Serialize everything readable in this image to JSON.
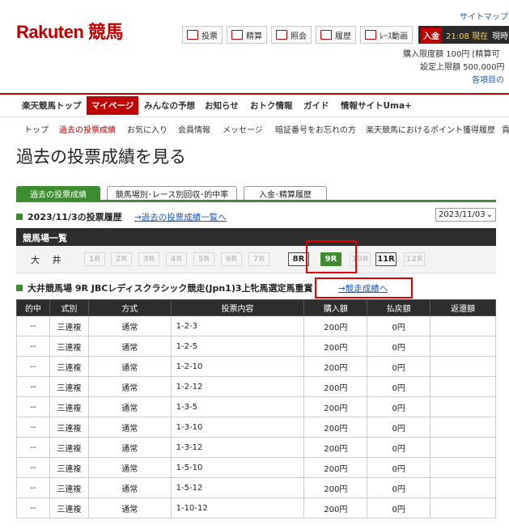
{
  "header": {
    "logo": "Rakuten 競馬",
    "sitemap": "サイトマップ",
    "tools": [
      {
        "label": "投票",
        "icon": "vote-icon"
      },
      {
        "label": "精算",
        "icon": "yen-icon"
      },
      {
        "label": "照会",
        "icon": "inquiry-icon"
      },
      {
        "label": "履歴",
        "icon": "history-icon"
      },
      {
        "label": "ﾚｰｽ動画",
        "icon": "race-video-icon"
      }
    ],
    "deposit_label": "入金",
    "deposit_time": "21:08 現在",
    "deposit_suffix": "現時",
    "limit_line1": "購入限度額 100円 [精算可",
    "limit_line2": "設定上限額 500,000円",
    "limit_line3": "各項目の"
  },
  "main_nav": [
    "楽天競馬トップ",
    "マイページ",
    "みんなの予想",
    "お知らせ",
    "おトク情報",
    "ガイド",
    "情報サイトUma+"
  ],
  "sub_nav": [
    "トップ",
    "過去の投票成績",
    "お気に入り",
    "会員情報",
    "メッセージ",
    "暗証番号をお忘れの方",
    "楽天競馬におけるポイント獲得履歴",
    "貢"
  ],
  "page_title": "過去の投票成績を見る",
  "tabs": [
    "過去の投票成績",
    "競馬場別･レース別回収･的中率",
    "入金･精算履歴"
  ],
  "history": {
    "heading": "2023/11/3の投票履歴",
    "link": "→過去の投票成績一覧へ",
    "date": "2023/11/03"
  },
  "venue": {
    "bar_title": "競馬場一覧",
    "name": "大 井",
    "races": [
      "1R",
      "2R",
      "3R",
      "4R",
      "5R",
      "6R",
      "7R",
      "8R",
      "9R",
      "10R",
      "11R",
      "12R"
    ],
    "active": [
      false,
      false,
      false,
      false,
      false,
      false,
      false,
      true,
      true,
      false,
      true,
      false
    ],
    "selected": "9R"
  },
  "race": {
    "heading": "大井競馬場 9R JBCレディスクラシック競走(Jpn1)3上牝馬選定馬重賞",
    "link": "→競走成績へ"
  },
  "table": {
    "headers": [
      "的中",
      "式別",
      "方式",
      "投票内容",
      "購入額",
      "払戻額",
      "返還額"
    ],
    "rows": [
      [
        "--",
        "三連複",
        "通常",
        "1-2-3",
        "200円",
        "0円",
        ""
      ],
      [
        "--",
        "三連複",
        "通常",
        "1-2-5",
        "200円",
        "0円",
        ""
      ],
      [
        "--",
        "三連複",
        "通常",
        "1-2-10",
        "200円",
        "0円",
        ""
      ],
      [
        "--",
        "三連複",
        "通常",
        "1-2-12",
        "200円",
        "0円",
        ""
      ],
      [
        "--",
        "三連複",
        "通常",
        "1-3-5",
        "200円",
        "0円",
        ""
      ],
      [
        "--",
        "三連複",
        "通常",
        "1-3-10",
        "200円",
        "0円",
        ""
      ],
      [
        "--",
        "三連複",
        "通常",
        "1-3-12",
        "200円",
        "0円",
        ""
      ],
      [
        "--",
        "三連複",
        "通常",
        "1-5-10",
        "200円",
        "0円",
        ""
      ],
      [
        "--",
        "三連複",
        "通常",
        "1-5-12",
        "200円",
        "0円",
        ""
      ],
      [
        "--",
        "三連複",
        "通常",
        "1-10-12",
        "200円",
        "0円",
        ""
      ]
    ]
  }
}
